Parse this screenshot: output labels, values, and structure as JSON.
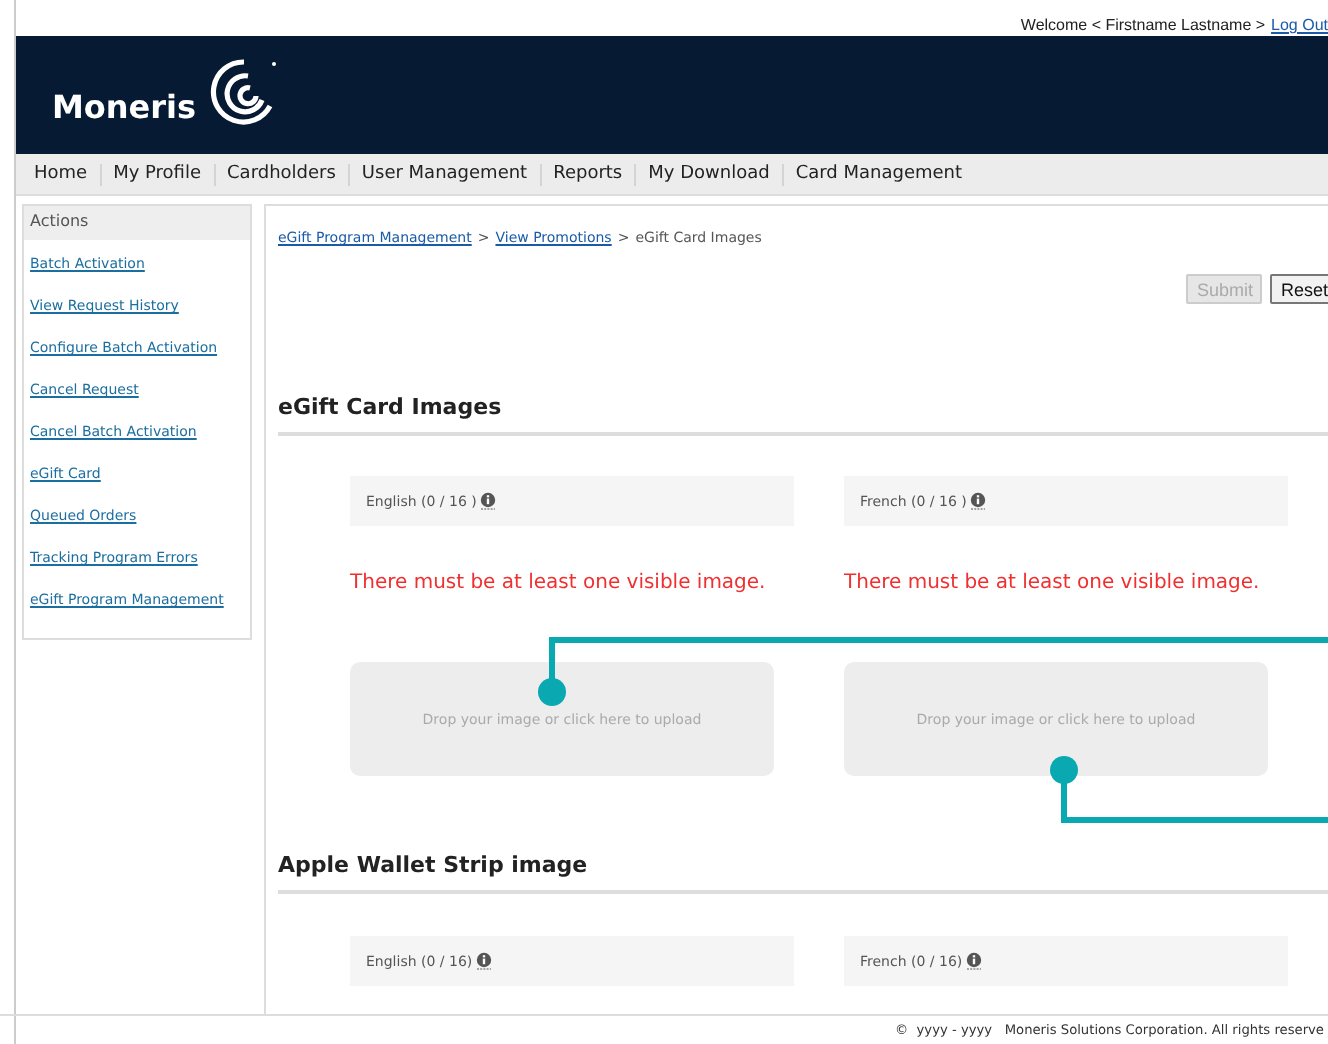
{
  "header": {
    "welcome": "Welcome < Firstname Lastname >",
    "logout": "Log Out",
    "logo": "Moneris"
  },
  "nav": [
    {
      "label": "Home"
    },
    {
      "label": "My Profile"
    },
    {
      "label": "Cardholders"
    },
    {
      "label": "User Management"
    },
    {
      "label": "Reports"
    },
    {
      "label": "My Download"
    },
    {
      "label": "Card Management"
    }
  ],
  "sidebar": {
    "title": "Actions",
    "items": [
      {
        "label": "Batch Activation"
      },
      {
        "label": "View Request History"
      },
      {
        "label": "Configure Batch Activation"
      },
      {
        "label": "Cancel Request"
      },
      {
        "label": "Cancel Batch Activation"
      },
      {
        "label": "eGift Card"
      },
      {
        "label": "Queued Orders"
      },
      {
        "label": "Tracking Program Errors"
      },
      {
        "label": "eGift Program Management"
      }
    ]
  },
  "breadcrumb": {
    "separator": ">",
    "items": [
      {
        "label": "eGift Program Management",
        "link": true
      },
      {
        "label": "View Promotions",
        "link": true
      },
      {
        "label": "eGift Card Images",
        "link": false
      }
    ]
  },
  "buttons": [
    {
      "label": "Submit",
      "disabled": true
    },
    {
      "label": "Reset",
      "disabled": false
    }
  ],
  "sections": [
    {
      "title": "eGift Card Images",
      "languages": [
        {
          "label": "English (0 / 16 )",
          "error": "There must be at least one visible image.",
          "upload": "Drop your image or click here to upload"
        },
        {
          "label": "French (0 / 16 )",
          "error": "There must be at least one visible image.",
          "upload": "Drop your image or click here to upload"
        }
      ]
    },
    {
      "title": "Apple Wallet Strip image",
      "languages": [
        {
          "label": "English (0 / 16)"
        },
        {
          "label": "French (0 / 16)"
        }
      ]
    }
  ],
  "footer": "©  yyyy - yyyy   Moneris Solutions Corporation. All rights reserve"
}
